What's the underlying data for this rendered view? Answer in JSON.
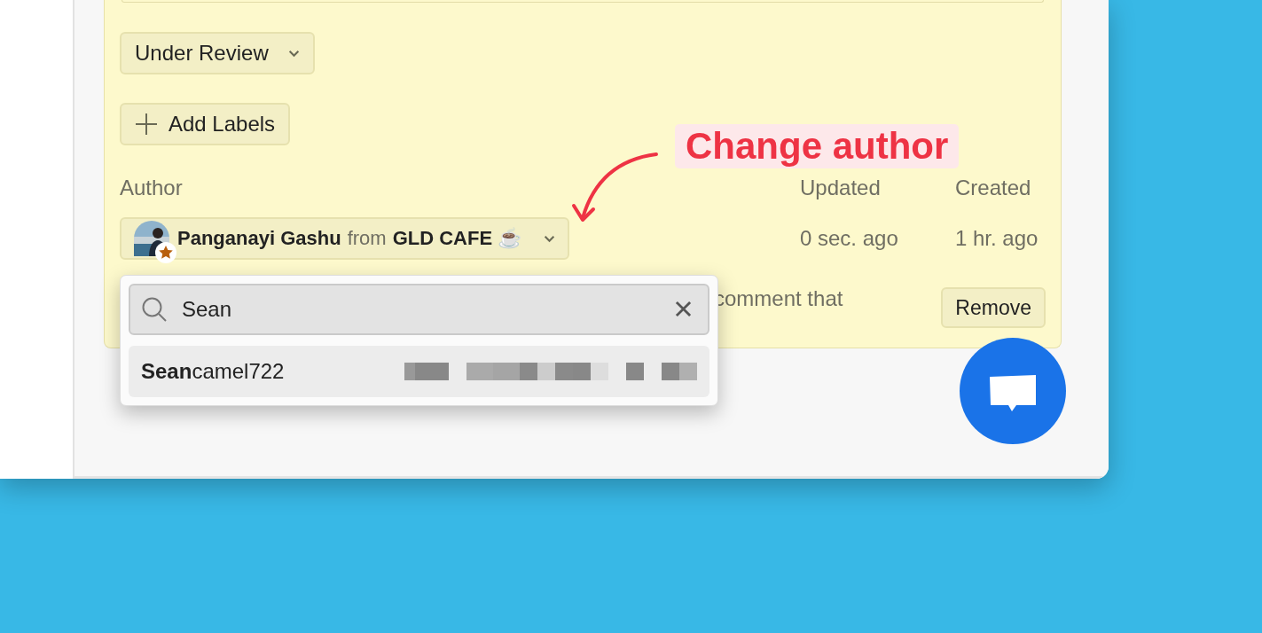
{
  "status_dropdown": {
    "label": "Under Review"
  },
  "add_labels_button": {
    "label": "Add Labels"
  },
  "author": {
    "label": "Author",
    "name": "Panganayi Gashu",
    "connector": "from",
    "company": "GLD CAFE ☕"
  },
  "updated": {
    "label": "Updated",
    "value": "0 sec. ago"
  },
  "created": {
    "label": "Created",
    "value": "1 hr. ago"
  },
  "comment_fragment": "comment that",
  "remove_button": {
    "label": "Remove"
  },
  "annotation": {
    "text": "Change author"
  },
  "author_picker": {
    "search": {
      "value": "Sean"
    },
    "results": [
      {
        "label": "**Sean**camel722",
        "selected": true
      }
    ]
  }
}
